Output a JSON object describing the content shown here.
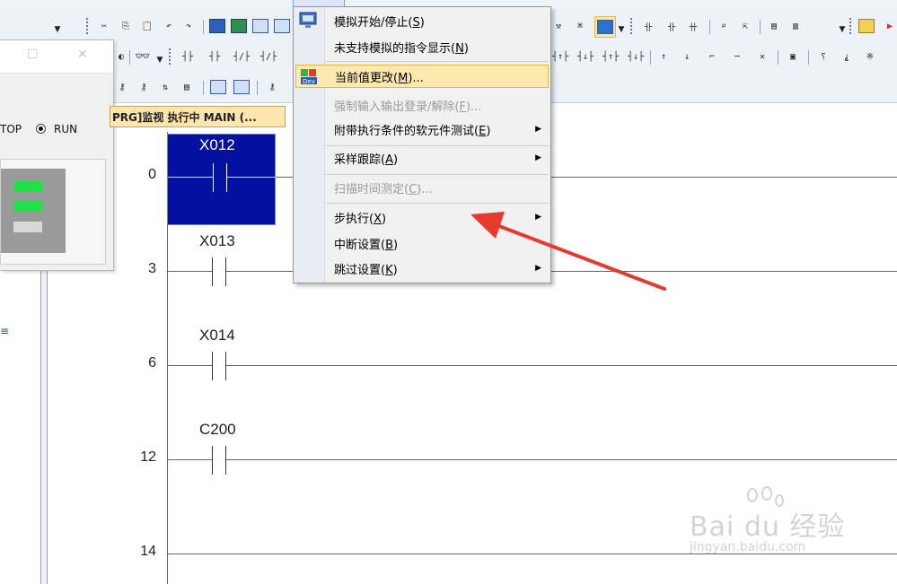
{
  "sim_window": {
    "mode_stop": "TOP",
    "mode_run": "RUN",
    "selected_mode": "RUN"
  },
  "editor": {
    "tab_title": "PRG]监视 执行中 MAIN (..."
  },
  "ladder": {
    "rungs": [
      {
        "step": "0",
        "device": "X012"
      },
      {
        "step": "3",
        "device": "X013"
      },
      {
        "step": "6",
        "device": "X014"
      },
      {
        "step": "12",
        "device": "C200"
      },
      {
        "step": "14",
        "device": ""
      }
    ]
  },
  "context_menu": {
    "items": [
      {
        "label": "模拟开始/停止",
        "key": "S",
        "enabled": true,
        "submenu": false,
        "highlighted": false
      },
      {
        "label": "未支持模拟的指令显示",
        "key": "N",
        "enabled": true,
        "submenu": false,
        "highlighted": false
      },
      {
        "label": "当前值更改",
        "key": "M",
        "suffix": "...",
        "enabled": true,
        "submenu": false,
        "highlighted": true
      },
      {
        "label": "强制输入输出登录/解除",
        "key": "F",
        "suffix": "...",
        "enabled": false,
        "submenu": false,
        "highlighted": false
      },
      {
        "label": "附带执行条件的软元件测试",
        "key": "E",
        "enabled": true,
        "submenu": true,
        "highlighted": false
      },
      {
        "label": "采样跟踪",
        "key": "A",
        "enabled": true,
        "submenu": true,
        "highlighted": false
      },
      {
        "label": "扫描时间测定",
        "key": "C",
        "suffix": "...",
        "enabled": false,
        "submenu": false,
        "highlighted": false
      },
      {
        "label": "步执行",
        "key": "X",
        "enabled": true,
        "submenu": true,
        "highlighted": false
      },
      {
        "label": "中断设置",
        "key": "B",
        "enabled": true,
        "submenu": false,
        "highlighted": false
      },
      {
        "label": "跳过设置",
        "key": "K",
        "enabled": true,
        "submenu": true,
        "highlighted": false
      }
    ]
  },
  "watermark": {
    "brand": "Bai du 经验",
    "url": "jingyan.baidu.com"
  },
  "colors": {
    "menu_highlight": "#fde8b0",
    "cursor_blue": "#0410a0",
    "annotation_arrow": "#e8392f",
    "tab_bg": "#fde6ae"
  }
}
